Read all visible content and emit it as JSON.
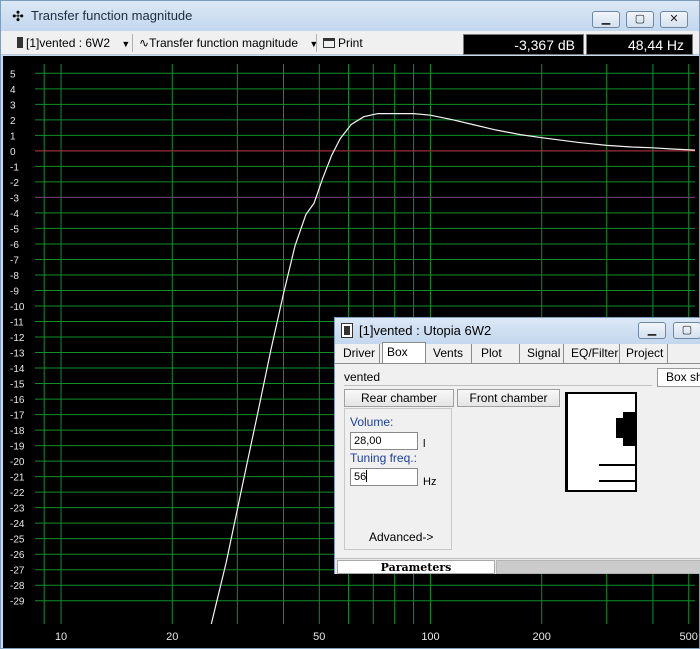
{
  "window": {
    "title": "Transfer function magnitude"
  },
  "toolbar": {
    "project_select": "[1]vented : 6W2",
    "function_select": "Transfer function magnitude",
    "print_label": "Print",
    "readout_db": "-3,367 dB",
    "readout_hz": "48,44 Hz"
  },
  "chart_data": {
    "type": "line",
    "title": "Transfer function magnitude",
    "xlabel": "",
    "ylabel": "",
    "x_scale": "log",
    "xlim": [
      8.5,
      520
    ],
    "ylim": [
      -30.5,
      5.6
    ],
    "x_ticks": [
      10,
      20,
      50,
      100,
      200,
      500
    ],
    "y_ticks": [
      5,
      4,
      3,
      2,
      1,
      0,
      -1,
      -2,
      -3,
      -4,
      -5,
      -6,
      -7,
      -8,
      -9,
      -10,
      -11,
      -12,
      -13,
      -14,
      -15,
      -16,
      -17,
      -18,
      -19,
      -20,
      -21,
      -22,
      -23,
      -24,
      -25,
      -26,
      -27,
      -28,
      -29
    ],
    "grid": true,
    "reference_lines": [
      {
        "y": 0,
        "color": "#c0203c"
      },
      {
        "y": -3,
        "color": "#7a2a78"
      }
    ],
    "series": [
      {
        "color": "#f4f4f4",
        "x": [
          25.5,
          28,
          31,
          34,
          37,
          40,
          43,
          46,
          48.4,
          51,
          54,
          57,
          61,
          66,
          72,
          80,
          90,
          100,
          115,
          130,
          150,
          175,
          200,
          250,
          300,
          350,
          400,
          450,
          520
        ],
        "y": [
          -30.5,
          -26.5,
          -21.5,
          -17,
          -12.8,
          -9.2,
          -6.1,
          -4.1,
          -3.37,
          -1.8,
          -0.3,
          0.8,
          1.7,
          2.2,
          2.4,
          2.4,
          2.4,
          2.3,
          2.0,
          1.7,
          1.35,
          1.05,
          0.85,
          0.55,
          0.35,
          0.25,
          0.2,
          0.12,
          0.05
        ]
      }
    ]
  },
  "box_dialog": {
    "title": "[1]vented : Utopia 6W2",
    "tabs": [
      "Driver",
      "Box",
      "Vents",
      "Plot",
      "Signal",
      "EQ/Filter",
      "Project"
    ],
    "active_tab": "Box",
    "box_name": "vented",
    "box_shape_button": "Box sh",
    "rear_chamber": "Rear chamber",
    "front_chamber": "Front chamber",
    "volume_label": "Volume:",
    "volume_value": "28,00",
    "volume_unit": "l",
    "tuning_label": "Tuning freq.:",
    "tuning_value": "56",
    "tuning_unit": "Hz",
    "advanced_label": "Advanced->",
    "status_tab": "Parameters"
  },
  "colors": {
    "plot_background": "#000000",
    "grid": "#0f8f2a",
    "tick_label": "#e6e6e6",
    "accent_label": "#1e3f9e"
  }
}
